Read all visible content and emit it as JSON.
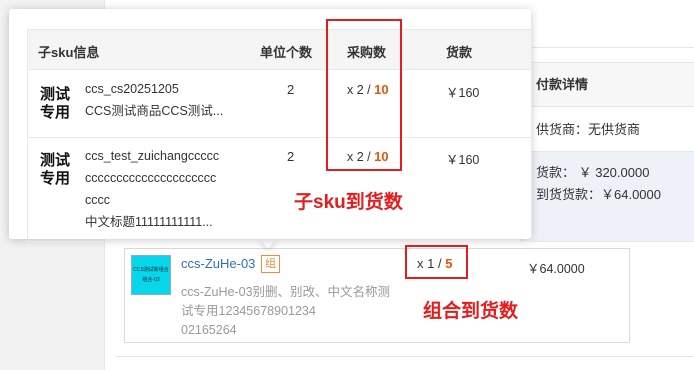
{
  "payment": {
    "title": "付款详情",
    "supplier": "供货商：无供货商",
    "amount": "货款： ￥ 320.0000",
    "arrival_amount": "到货货款：￥64.0000"
  },
  "combo": {
    "thumb_line1": "CCS测试新组合",
    "thumb_line2": "组合-03",
    "code": "ccs-ZuHe-03",
    "tag": "组",
    "desc_line1": "ccs-ZuHe-03别删、别改、中文名称测",
    "desc_line2": "试专用12345678901234",
    "desc_line3": "02165264",
    "qty_prefix": "x 1 / ",
    "qty_arrived": "5",
    "price": "￥64.0000"
  },
  "popover": {
    "headers": {
      "sku_info": "子sku信息",
      "unit_count": "单位个数",
      "purchase_qty": "采购数",
      "payment": "货款"
    },
    "rows": [
      {
        "image_text_1": "测试",
        "image_text_2": "专用",
        "code": "ccs_cs20251205",
        "name": "CCS测试商品CCS测试...",
        "unit": "2",
        "qty_prefix": "x 2 / ",
        "qty_arrived": "10",
        "price": "￥160"
      },
      {
        "image_text_1": "测试",
        "image_text_2": "专用",
        "code": "ccs_test_zuichangccccc",
        "name_line1": "ccccccccccccccccccccc",
        "name_line2": "cccc",
        "name_line3": "中文标题11111111111...",
        "unit": "2",
        "qty_prefix": "x 2 / ",
        "qty_arrived": "10",
        "price": "￥160"
      }
    ]
  },
  "annotations": {
    "sub_sku_label": "子sku到货数",
    "combo_label": "组合到货数"
  },
  "colors": {
    "highlight_red": "#e61c1c",
    "arrived_orange": "#e8540a",
    "link_blue": "#2d6fc4"
  }
}
